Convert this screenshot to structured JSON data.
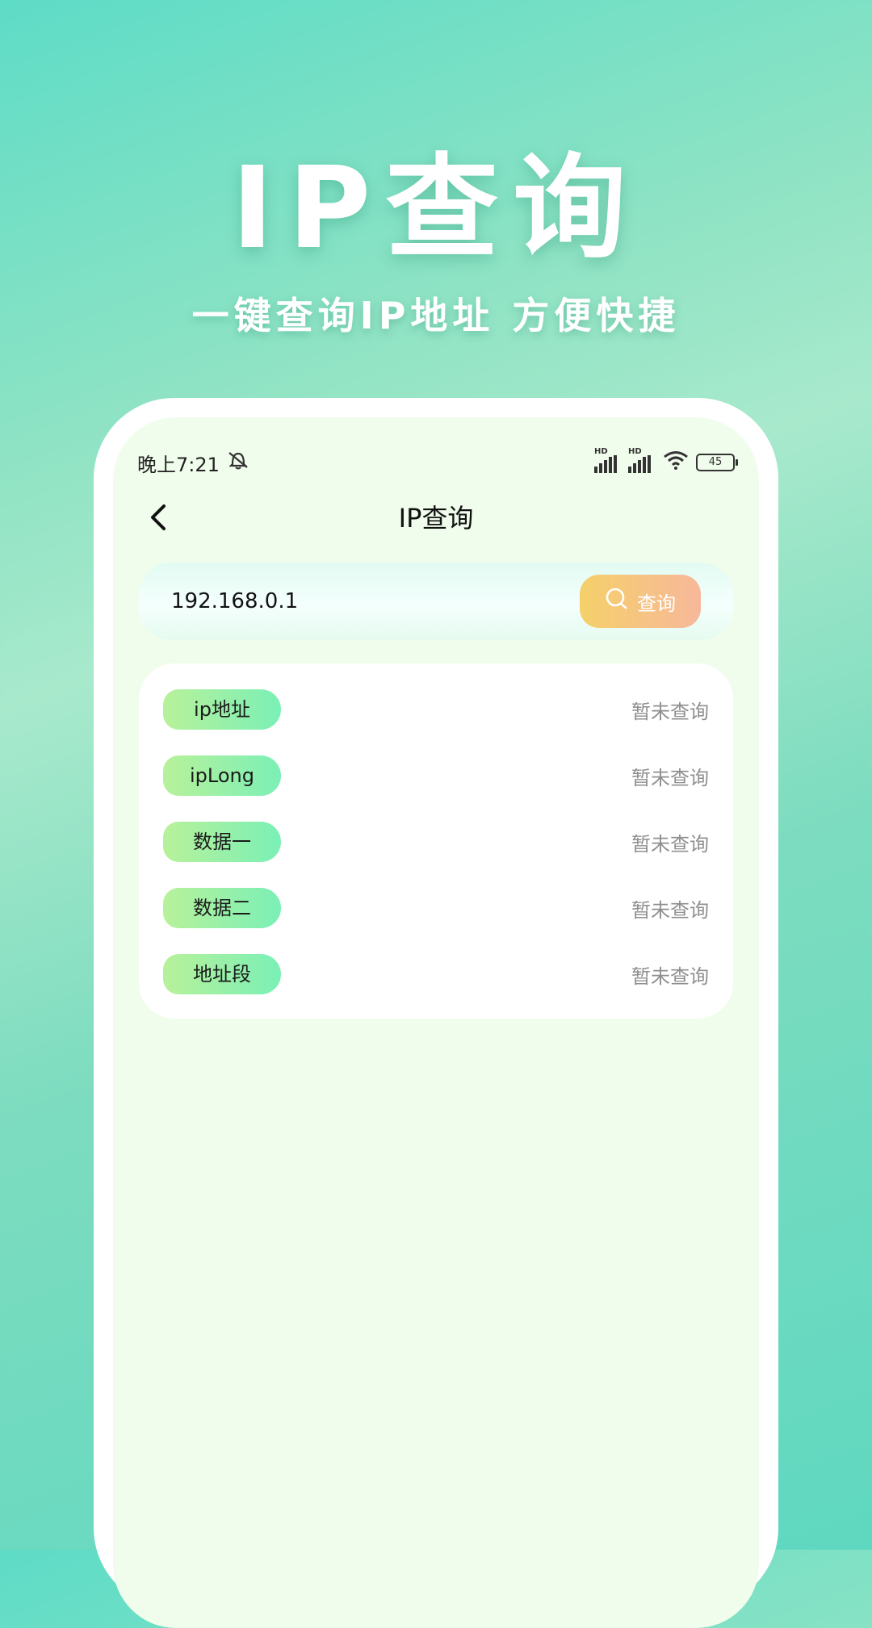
{
  "hero": {
    "title": "IP查询",
    "subtitle": "一键查询IP地址 方便快捷"
  },
  "status_bar": {
    "time": "晚上7:21",
    "battery": "45",
    "hd_label": "HD"
  },
  "nav": {
    "title": "IP查询"
  },
  "search": {
    "value": "192.168.0.1",
    "button_label": "查询"
  },
  "results": [
    {
      "label": "ip地址",
      "value": "暂未查询"
    },
    {
      "label": "ipLong",
      "value": "暂未查询"
    },
    {
      "label": "数据一",
      "value": "暂未查询"
    },
    {
      "label": "数据二",
      "value": "暂未查询"
    },
    {
      "label": "地址段",
      "value": "暂未查询"
    }
  ],
  "colors": {
    "accent_gradient_start": "#f5d06a",
    "accent_gradient_end": "#f7b89a",
    "tag_gradient_start": "#b8f19a",
    "tag_gradient_end": "#7af0b6",
    "screen_bg": "#f1fdec"
  },
  "icons": {
    "back": "chevron-left-icon",
    "search": "search-icon",
    "mute": "bell-off-icon",
    "wifi": "wifi-icon",
    "signal": "signal-icon",
    "battery": "battery-icon"
  }
}
